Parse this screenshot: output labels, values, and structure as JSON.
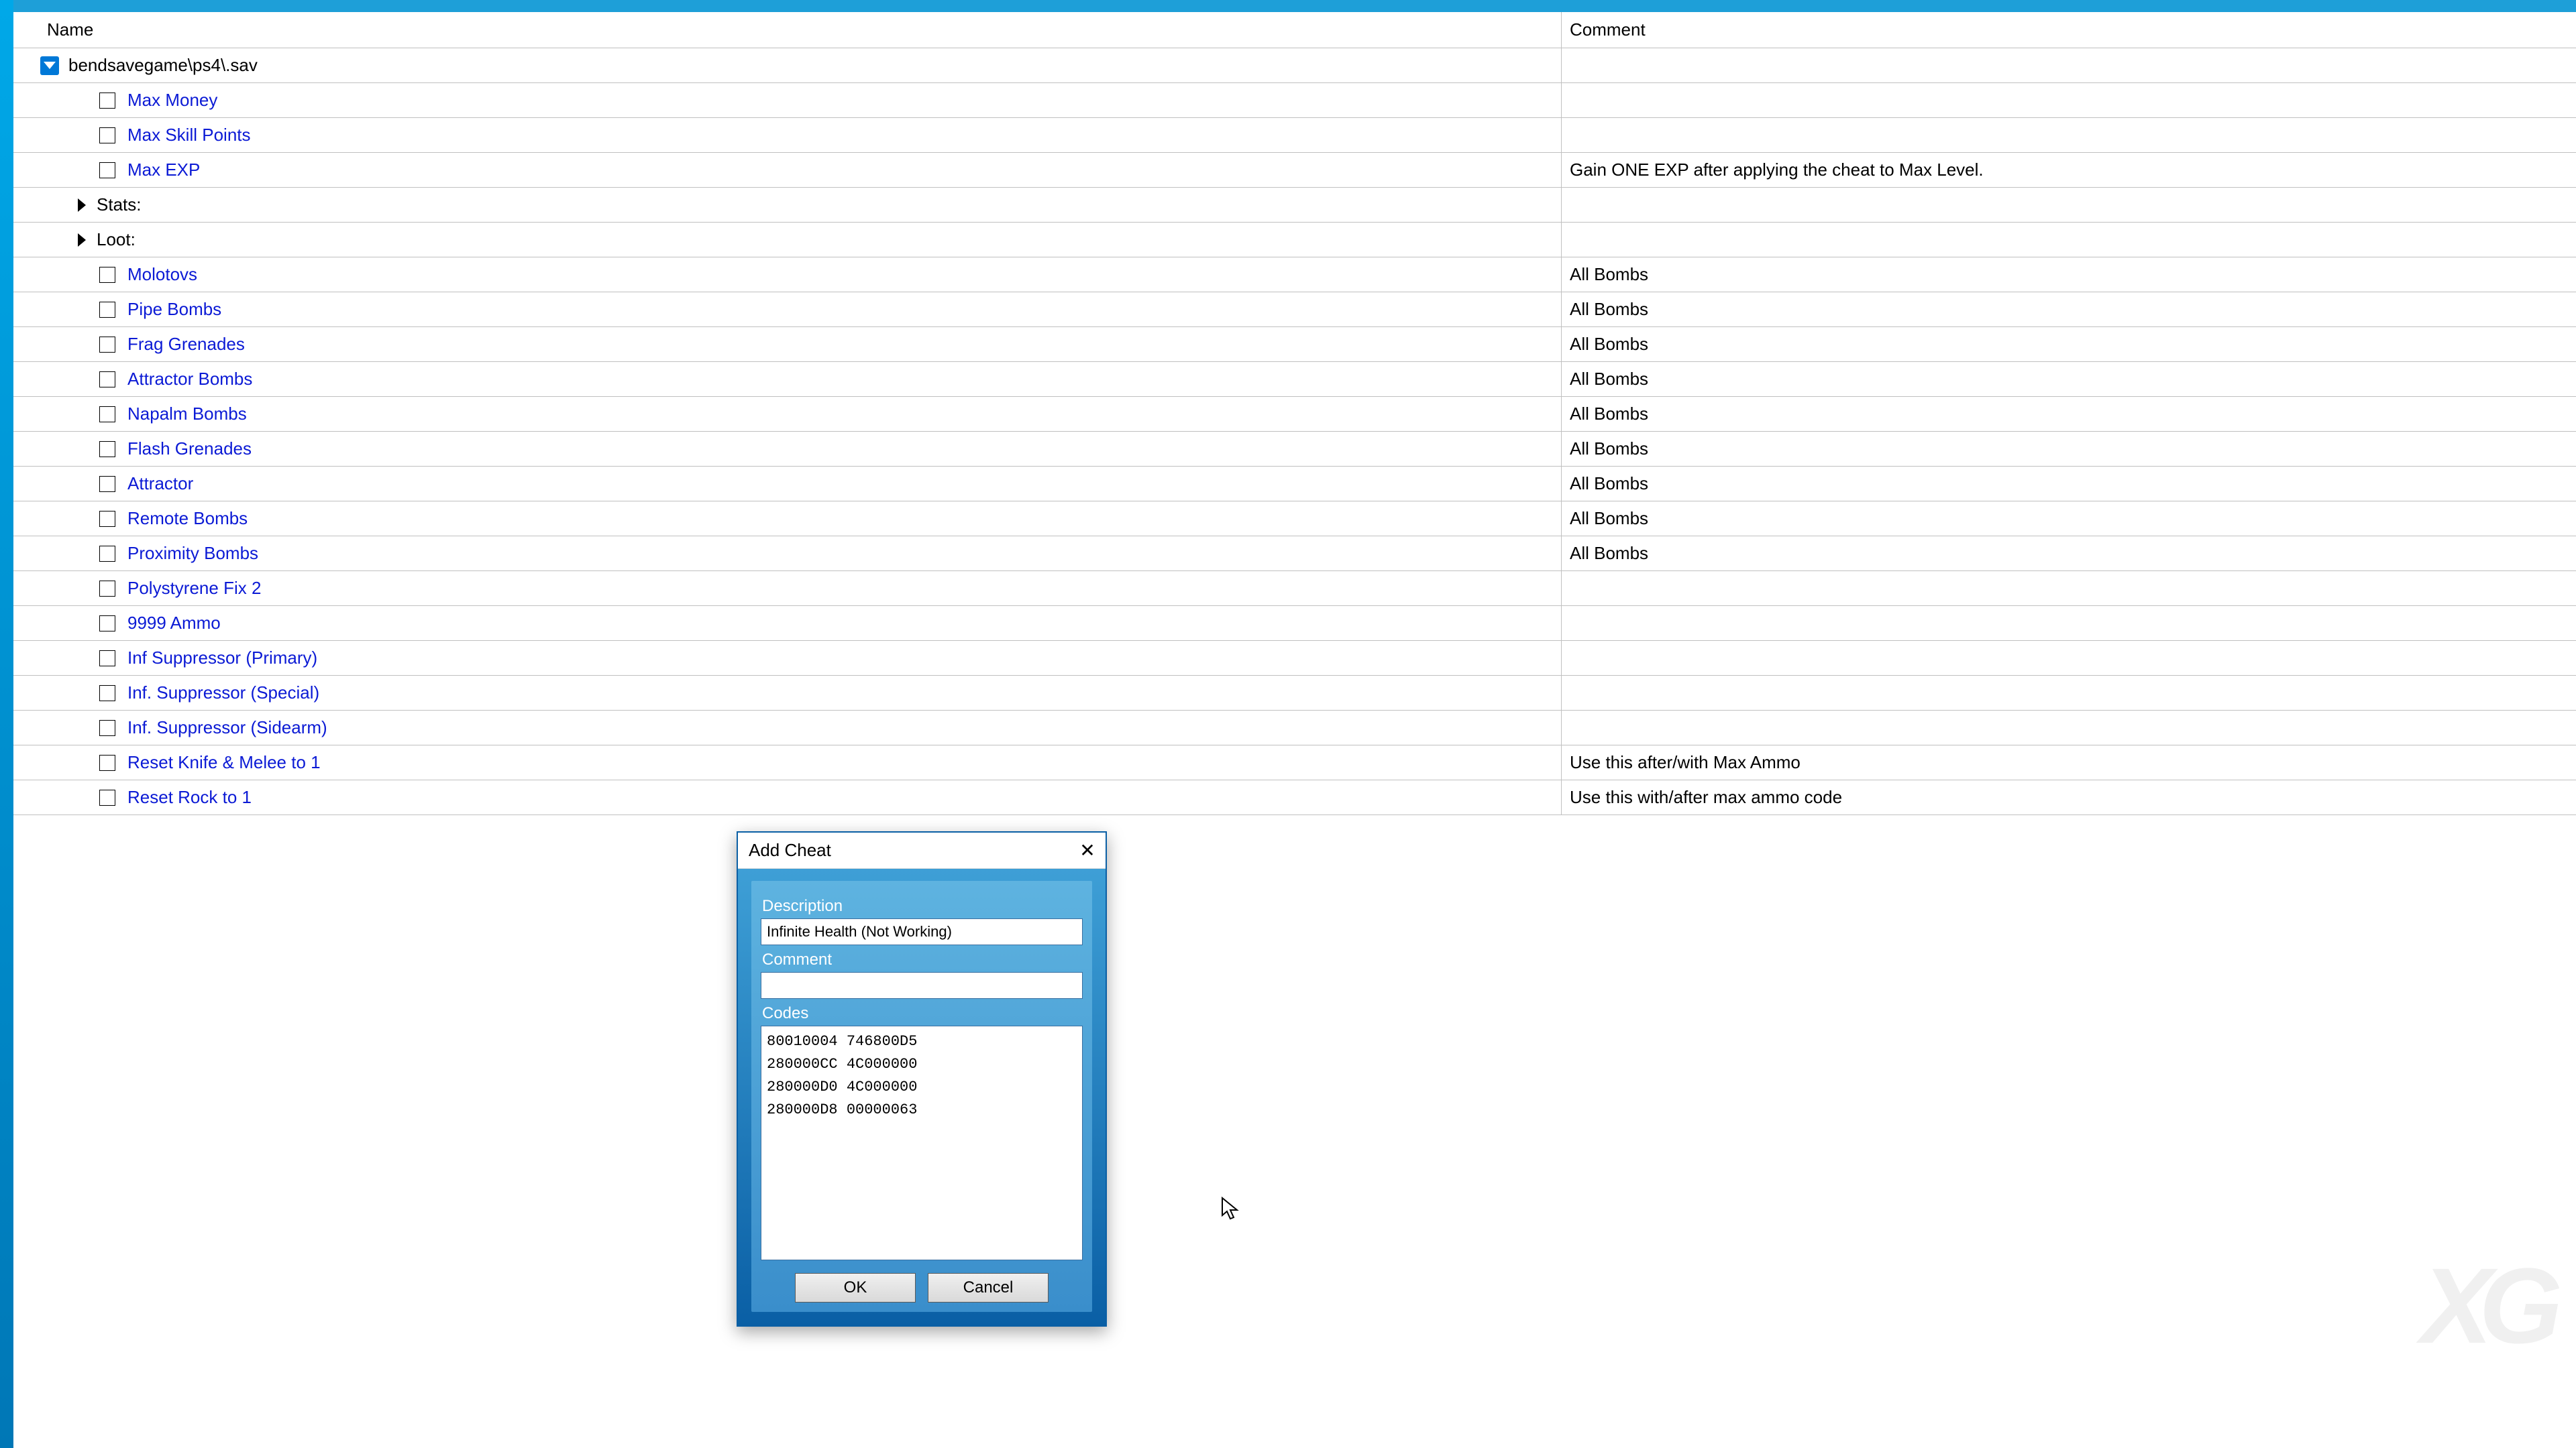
{
  "table": {
    "headers": {
      "name": "Name",
      "comment": "Comment"
    },
    "root": {
      "label": "bendsavegame\\ps4\\.sav"
    },
    "rows": [
      {
        "type": "item",
        "name": "Max Money",
        "comment": ""
      },
      {
        "type": "item",
        "name": "Max Skill Points",
        "comment": ""
      },
      {
        "type": "item",
        "name": "Max EXP",
        "comment": "Gain ONE EXP after applying the cheat to Max Level."
      },
      {
        "type": "group",
        "name": "Stats:"
      },
      {
        "type": "group",
        "name": "Loot:"
      },
      {
        "type": "item",
        "name": "Molotovs",
        "comment": "All Bombs"
      },
      {
        "type": "item",
        "name": "Pipe Bombs",
        "comment": "All Bombs"
      },
      {
        "type": "item",
        "name": "Frag Grenades",
        "comment": "All Bombs"
      },
      {
        "type": "item",
        "name": "Attractor Bombs",
        "comment": "All Bombs"
      },
      {
        "type": "item",
        "name": "Napalm Bombs",
        "comment": "All Bombs"
      },
      {
        "type": "item",
        "name": "Flash Grenades",
        "comment": "All Bombs"
      },
      {
        "type": "item",
        "name": "Attractor",
        "comment": "All Bombs"
      },
      {
        "type": "item",
        "name": "Remote Bombs",
        "comment": "All Bombs"
      },
      {
        "type": "item",
        "name": "Proximity Bombs",
        "comment": "All Bombs"
      },
      {
        "type": "item",
        "name": "Polystyrene Fix 2",
        "comment": ""
      },
      {
        "type": "item",
        "name": "9999 Ammo",
        "comment": ""
      },
      {
        "type": "item",
        "name": "Inf Suppressor (Primary)",
        "comment": ""
      },
      {
        "type": "item",
        "name": "Inf. Suppressor (Special)",
        "comment": ""
      },
      {
        "type": "item",
        "name": "Inf. Suppressor (Sidearm)",
        "comment": ""
      },
      {
        "type": "item",
        "name": "Reset Knife & Melee to 1",
        "comment": "Use this after/with Max Ammo"
      },
      {
        "type": "item",
        "name": "Reset Rock to 1",
        "comment": "Use this with/after max ammo code"
      }
    ]
  },
  "dialog": {
    "title": "Add Cheat",
    "description_label": "Description",
    "description_value": "Infinite Health (Not Working)",
    "comment_label": "Comment",
    "comment_value": "",
    "codes_label": "Codes",
    "codes_value": "80010004 746800D5\n280000CC 4C000000\n280000D0 4C000000\n280000D8 00000063",
    "ok": "OK",
    "cancel": "Cancel"
  },
  "watermark": "XG"
}
